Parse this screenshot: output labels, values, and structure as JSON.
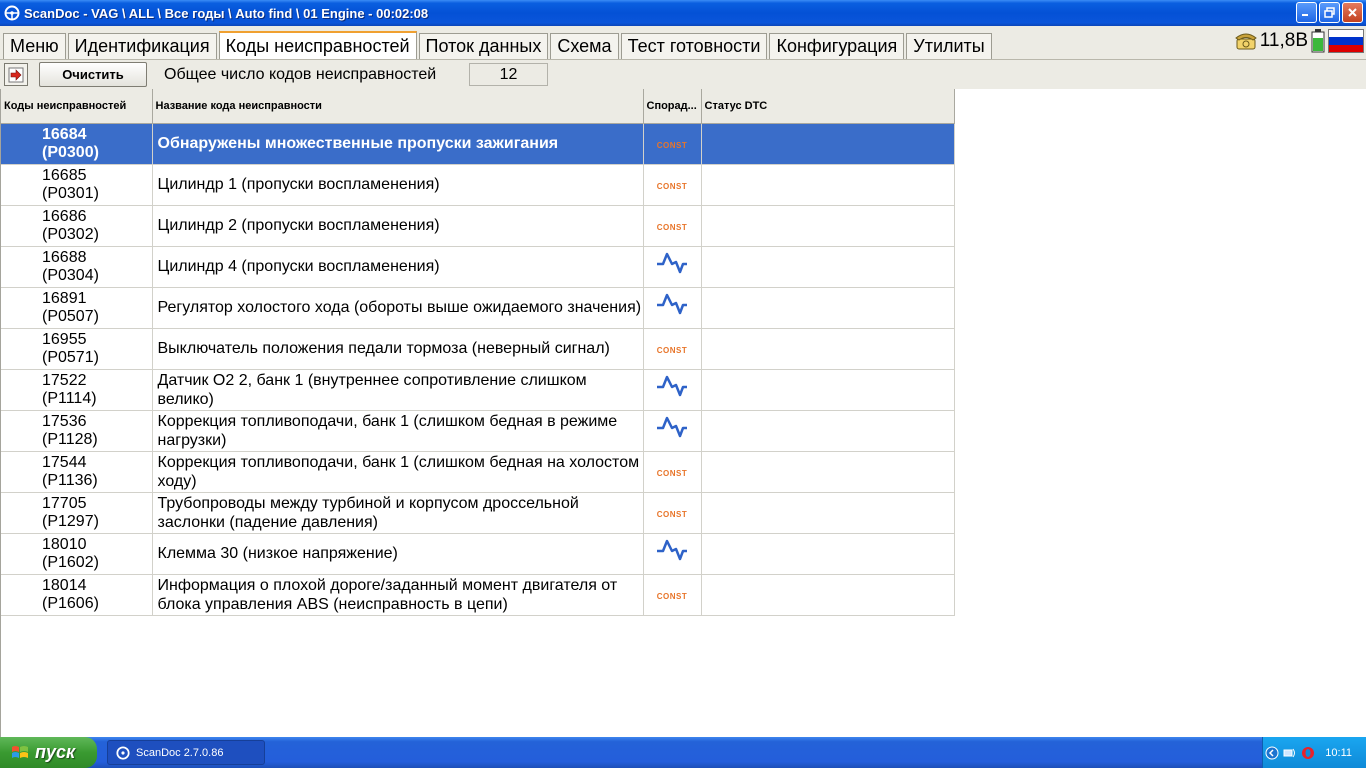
{
  "window": {
    "title": "ScanDoc - VAG \\ ALL \\ Все годы \\ Auto find \\ 01 Engine - 00:02:08"
  },
  "tabs": [
    {
      "label": "Меню",
      "active": false
    },
    {
      "label": "Идентификация",
      "active": false
    },
    {
      "label": "Коды неисправностей",
      "active": true
    },
    {
      "label": "Поток данных",
      "active": false
    },
    {
      "label": "Схема",
      "active": false
    },
    {
      "label": "Тест готовности",
      "active": false
    },
    {
      "label": "Конфигурация",
      "active": false
    },
    {
      "label": "Утилиты",
      "active": false
    }
  ],
  "status": {
    "voltage": "11,8В",
    "flag_colors": [
      "#ffffff",
      "#0033cc",
      "#dd0000"
    ]
  },
  "toolbar": {
    "clear_label": "Очистить",
    "total_label": "Общее число кодов неисправностей",
    "total_count": "12"
  },
  "table": {
    "columns": [
      "Коды неисправностей",
      "Название кода неисправности",
      "Спорад...",
      "Статус DTC"
    ],
    "rows": [
      {
        "code": "16684",
        "pcode": "(P0300)",
        "desc": "Обнаружены множественные пропуски зажигания",
        "type": "const",
        "selected": true
      },
      {
        "code": "16685",
        "pcode": "(P0301)",
        "desc": "Цилиндр 1 (пропуски воспламенения)",
        "type": "const",
        "selected": false
      },
      {
        "code": "16686",
        "pcode": "(P0302)",
        "desc": "Цилиндр 2 (пропуски воспламенения)",
        "type": "const",
        "selected": false
      },
      {
        "code": "16688",
        "pcode": "(P0304)",
        "desc": "Цилиндр 4 (пропуски воспламенения)",
        "type": "sporadic",
        "selected": false
      },
      {
        "code": "16891",
        "pcode": "(P0507)",
        "desc": "Регулятор холостого хода (обороты выше ожидаемого значения)",
        "type": "sporadic",
        "selected": false
      },
      {
        "code": "16955",
        "pcode": "(P0571)",
        "desc": "Выключатель положения педали тормоза (неверный сигнал)",
        "type": "const",
        "selected": false
      },
      {
        "code": "17522",
        "pcode": "(P1114)",
        "desc": "Датчик O2 2, банк 1 (внутреннее сопротивление слишком велико)",
        "type": "sporadic",
        "selected": false
      },
      {
        "code": "17536",
        "pcode": "(P1128)",
        "desc": "Коррекция топливоподачи, банк 1 (слишком бедная в режиме нагрузки)",
        "type": "sporadic",
        "selected": false
      },
      {
        "code": "17544",
        "pcode": "(P1136)",
        "desc": "Коррекция топливоподачи, банк 1 (слишком бедная на холостом ходу)",
        "type": "const",
        "selected": false
      },
      {
        "code": "17705",
        "pcode": "(P1297)",
        "desc": "Трубопроводы между турбиной и корпусом дроссельной заслонки (падение давления)",
        "type": "const",
        "selected": false
      },
      {
        "code": "18010",
        "pcode": "(P1602)",
        "desc": "Клемма 30 (низкое напряжение)",
        "type": "sporadic",
        "selected": false
      },
      {
        "code": "18014",
        "pcode": "(P1606)",
        "desc": "Информация о плохой дороге/заданный момент двигателя от блока управления ABS (неисправность в цепи)",
        "type": "const",
        "selected": false
      }
    ],
    "const_label": "CONST"
  },
  "taskbar": {
    "start_label": "пуск",
    "task_label": "ScanDoc 2.7.0.86",
    "clock": "10:11"
  }
}
